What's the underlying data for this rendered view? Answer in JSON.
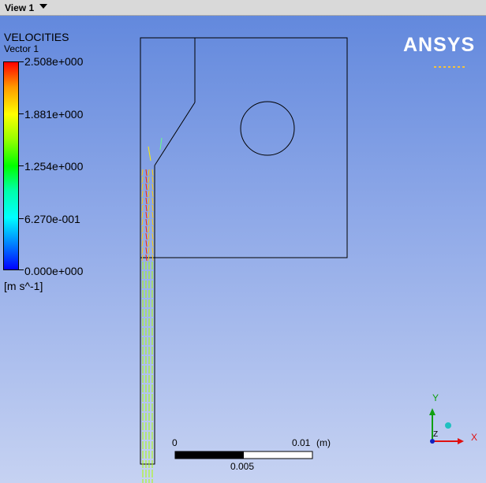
{
  "view_tab": {
    "label": "View 1"
  },
  "legend": {
    "title": "VELOCITIES",
    "subtitle": "Vector 1",
    "ticks": [
      "2.508e+000",
      "1.881e+000",
      "1.254e+000",
      "6.270e-001",
      "0.000e+000"
    ],
    "units": "[m s^-1]"
  },
  "logo": {
    "text": "ANSYS"
  },
  "scale_bar": {
    "label_start": "0",
    "label_end": "0.01",
    "unit": "(m)",
    "label_mid": "0.005"
  },
  "axes": {
    "x": "X",
    "y": "Y",
    "z": "Z"
  },
  "colors": {
    "max": "#ff0000",
    "mid": "#00ff00",
    "min": "#0000ff",
    "vector_low": "#aaff00"
  }
}
